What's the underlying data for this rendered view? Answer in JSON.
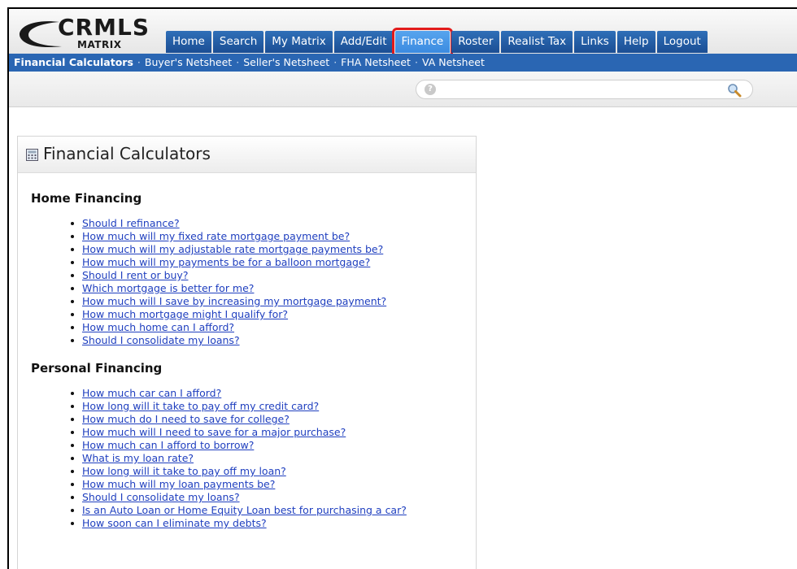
{
  "logo": {
    "main": "CRMLS",
    "sub": "MATRIX"
  },
  "nav": {
    "items": [
      {
        "label": "Home"
      },
      {
        "label": "Search"
      },
      {
        "label": "My Matrix"
      },
      {
        "label": "Add/Edit"
      },
      {
        "label": "Finance"
      },
      {
        "label": "Roster"
      },
      {
        "label": "Realist Tax"
      },
      {
        "label": "Links"
      },
      {
        "label": "Help"
      },
      {
        "label": "Logout"
      }
    ],
    "active": "Finance"
  },
  "subnav": {
    "items": [
      {
        "label": "Financial Calculators"
      },
      {
        "label": "Buyer's Netsheet"
      },
      {
        "label": "Seller's Netsheet"
      },
      {
        "label": "FHA Netsheet"
      },
      {
        "label": "VA Netsheet"
      }
    ],
    "separator": "·"
  },
  "search": {
    "value": "",
    "placeholder": "",
    "help_glyph": "?"
  },
  "panel": {
    "title": "Financial Calculators",
    "home": {
      "heading": "Home Financing",
      "links": [
        "Should I refinance?",
        "How much will my fixed rate mortgage payment be?",
        "How much will my adjustable rate mortgage payments be?",
        "How much will my payments be for a balloon mortgage?",
        "Should I rent or buy?",
        "Which mortgage is better for me?",
        "How much will I save by increasing my mortgage payment?",
        "How much mortgage might I qualify for?",
        "How much home can I afford?",
        "Should I consolidate my loans?"
      ]
    },
    "personal": {
      "heading": "Personal Financing",
      "links": [
        "How much car can I afford?",
        "How long will it take to pay off my credit card?",
        "How much do I need to save for college?",
        "How much will I need to save for a major purchase?",
        "How much can I afford to borrow?",
        "What is my loan rate?",
        "How long will it take to pay off my loan?",
        "How much will my loan payments be?",
        "Should I consolidate my loans?",
        "Is an Auto Loan or Home Equity Loan best for purchasing a car?",
        "How soon can I eliminate my debts?"
      ]
    }
  },
  "colors": {
    "nav_blue": "#1b4e94",
    "nav_active": "#3b8be0",
    "highlight_red": "#e21b1b",
    "link": "#1f3fbf",
    "subnav_blue": "#2a66b3"
  },
  "icons": [
    "logo-swoosh-icon",
    "help-icon",
    "search-icon",
    "calculator-icon"
  ]
}
